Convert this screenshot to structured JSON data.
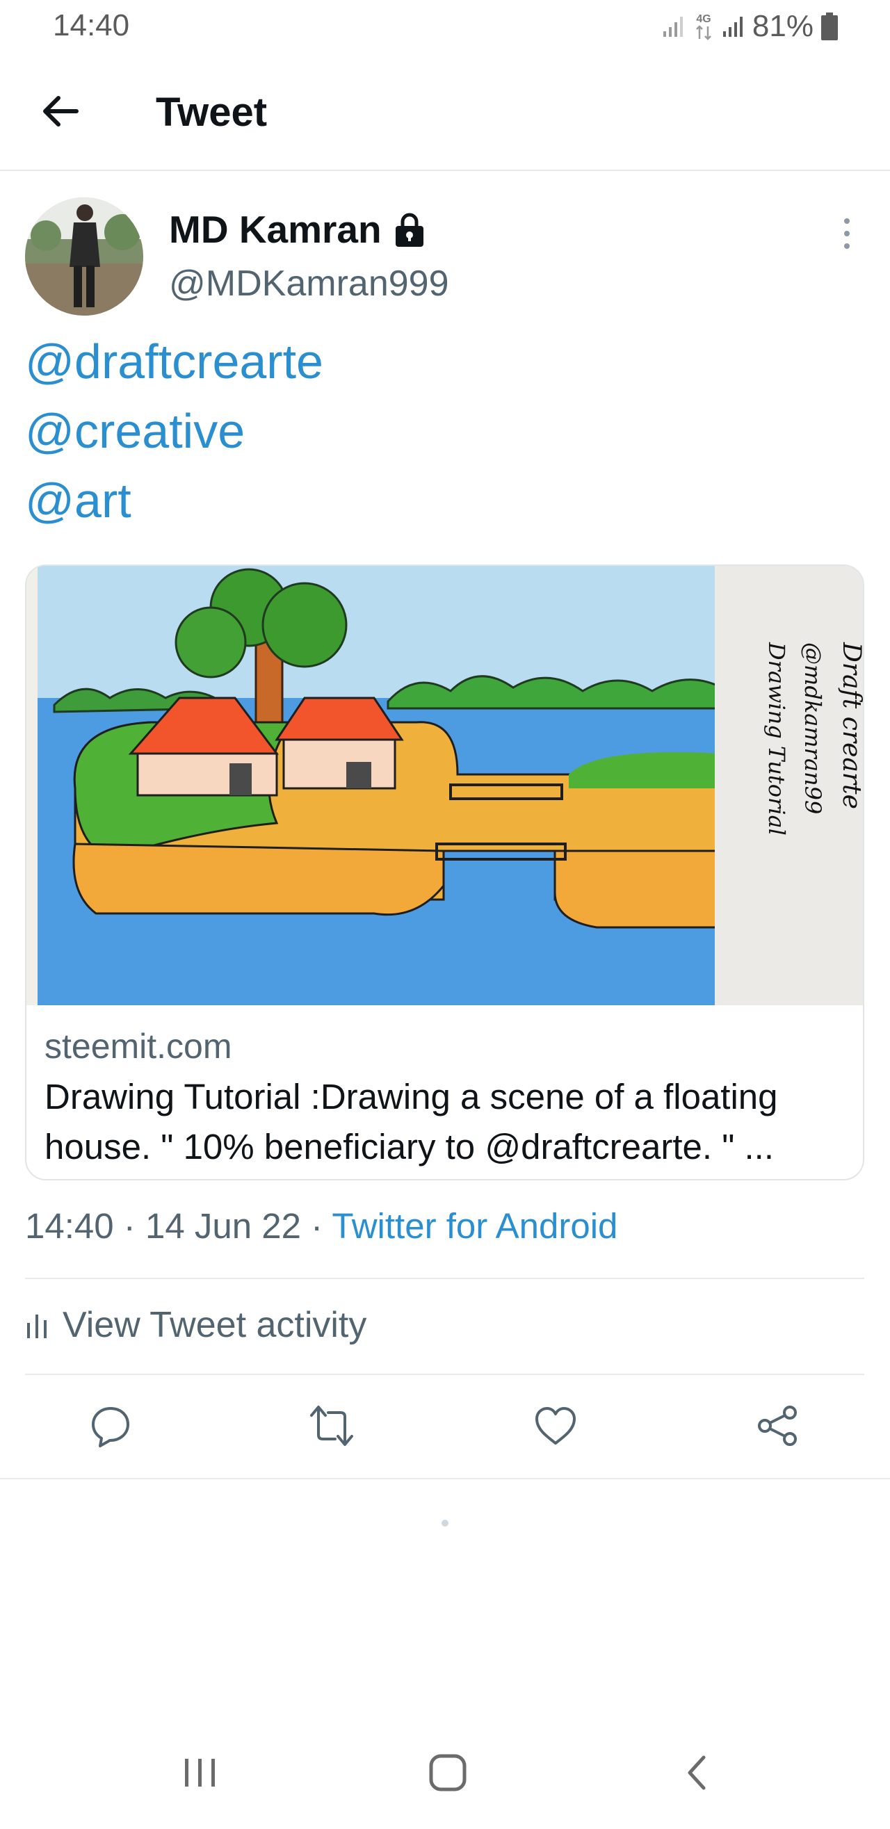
{
  "status_bar": {
    "time": "14:40",
    "network": "4G",
    "battery": "81%",
    "icons": [
      "signal-icon",
      "network-4g-icon",
      "signal-icon",
      "battery-icon"
    ]
  },
  "header": {
    "title": "Tweet",
    "back_icon": "arrow-left-icon"
  },
  "tweet": {
    "author": {
      "display_name": "MD Kamran",
      "username": "@MDKamran999",
      "protected_icon": "lock-icon"
    },
    "mentions": [
      "@draftcrearte",
      "@creative",
      "@art"
    ],
    "card": {
      "domain": "steemit.com",
      "title": "Drawing Tutorial :Drawing a scene of a floating house. \" 10% beneficiary to @draftcrearte. \" ...",
      "image_caption_lines": [
        "Draft crearte",
        "@mdkamran99",
        "Drawing Tutorial"
      ]
    },
    "meta": {
      "time": "14:40",
      "separator": "·",
      "date": "14 Jun 22",
      "source": "Twitter for Android"
    },
    "activity_label": "View Tweet activity",
    "actions": [
      "reply-icon",
      "retweet-icon",
      "like-icon",
      "share-icon"
    ]
  },
  "colors": {
    "link": "#2a8fd0",
    "text": "#0f1419",
    "secondary": "#536471",
    "divider": "#e7e9ea"
  },
  "nav_bar": [
    "recents-icon",
    "home-icon",
    "back-icon"
  ]
}
